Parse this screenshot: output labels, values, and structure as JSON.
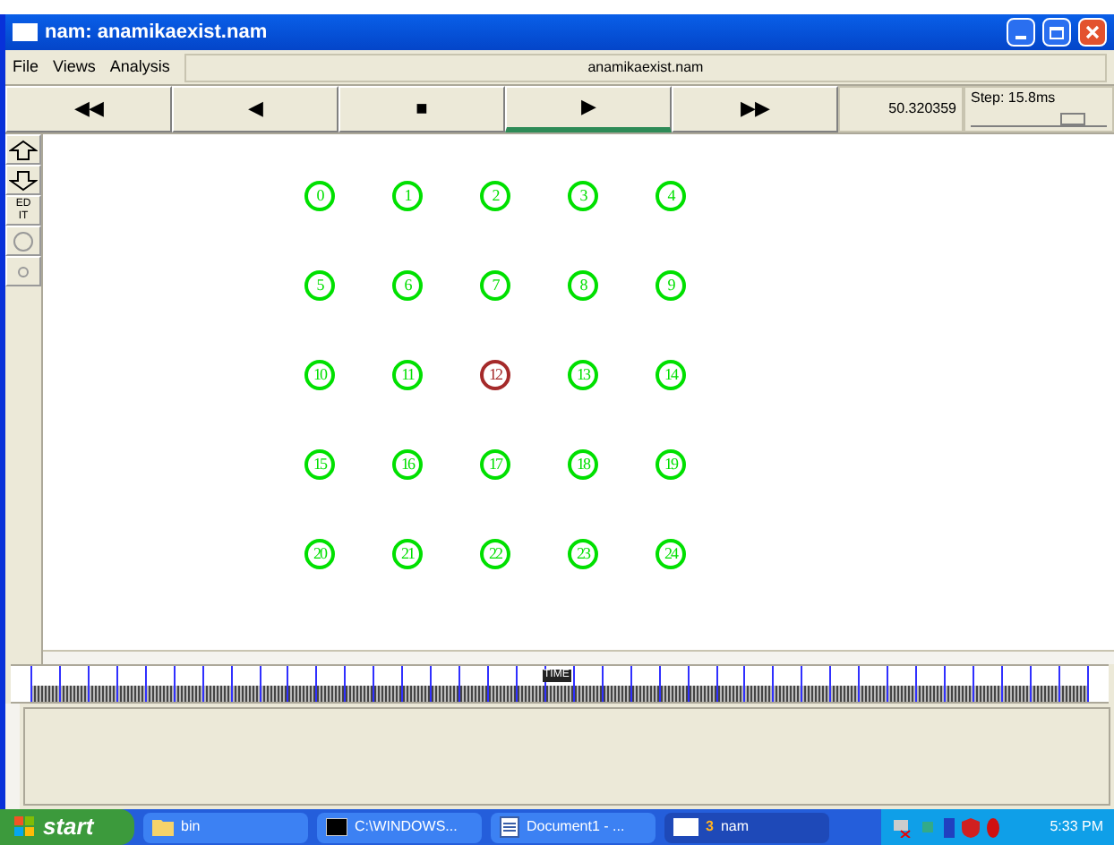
{
  "window": {
    "title": "nam: anamikaexist.nam"
  },
  "menu": [
    "File",
    "Views",
    "Analysis"
  ],
  "file_label": "anamikaexist.nam",
  "controls": [
    {
      "symbol": "◀◀",
      "selected": false
    },
    {
      "symbol": "◀",
      "selected": false
    },
    {
      "symbol": "■",
      "selected": false
    },
    {
      "symbol": "▶",
      "selected": true
    },
    {
      "symbol": "▶▶",
      "selected": false
    }
  ],
  "time": "50.320359",
  "step": {
    "label": "Step: 15.8ms",
    "level": 0.75
  },
  "tools": [
    {
      "kind": "zoom-in"
    },
    {
      "kind": "zoom-out"
    },
    {
      "kind": "edit",
      "label": "ED IT"
    },
    {
      "kind": "big-circle"
    },
    {
      "kind": "small-circle"
    }
  ],
  "nodes": [
    {
      "label": "0",
      "color": "#00e000"
    },
    {
      "label": "1",
      "color": "#00e000"
    },
    {
      "label": "2",
      "color": "#00e000"
    },
    {
      "label": "3",
      "color": "#00e000"
    },
    {
      "label": "4",
      "color": "#00e000"
    },
    {
      "label": "5",
      "color": "#00e000"
    },
    {
      "label": "6",
      "color": "#00e000"
    },
    {
      "label": "7",
      "color": "#00e000"
    },
    {
      "label": "8",
      "color": "#00e000"
    },
    {
      "label": "9",
      "color": "#00e000"
    },
    {
      "label": "10",
      "color": "#00e000"
    },
    {
      "label": "11",
      "color": "#00e000"
    },
    {
      "label": "12",
      "color": "#a52a2a"
    },
    {
      "label": "13",
      "color": "#00e000"
    },
    {
      "label": "14",
      "color": "#00e000"
    },
    {
      "label": "15",
      "color": "#00e000"
    },
    {
      "label": "16",
      "color": "#00e000"
    },
    {
      "label": "17",
      "color": "#00e000"
    },
    {
      "label": "18",
      "color": "#00e000"
    },
    {
      "label": "19",
      "color": "#00e000"
    },
    {
      "label": "20",
      "color": "#00e000"
    },
    {
      "label": "21",
      "color": "#00e000"
    },
    {
      "label": "22",
      "color": "#00e000"
    },
    {
      "label": "23",
      "color": "#00e000"
    },
    {
      "label": "24",
      "color": "#00e000"
    }
  ],
  "timeline": {
    "label": "TIME",
    "level": 0.5
  },
  "taskbar": {
    "start": "start",
    "tasks": [
      {
        "kind": "folder",
        "label": "bin",
        "selected": false
      },
      {
        "kind": "console",
        "label": "C:\\WINDOWS...",
        "selected": false
      },
      {
        "kind": "document",
        "label": "Document1 - ...",
        "selected": false
      },
      {
        "kind": "window",
        "label": "nam",
        "count": "3",
        "selected": true
      }
    ],
    "clock": "5:33 PM"
  }
}
